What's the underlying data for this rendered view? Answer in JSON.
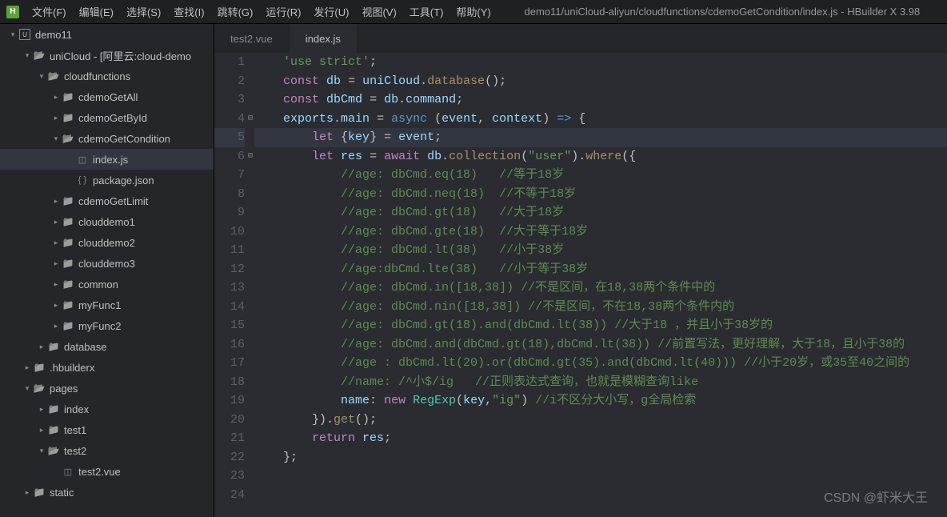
{
  "menubar": {
    "logo": "H",
    "items": [
      "文件(F)",
      "编辑(E)",
      "选择(S)",
      "查找(I)",
      "跳转(G)",
      "运行(R)",
      "发行(U)",
      "视图(V)",
      "工具(T)",
      "帮助(Y)"
    ],
    "title": "demo11/uniCloud-aliyun/cloudfunctions/cdemoGetCondition/index.js - HBuilder X 3.98"
  },
  "tree": [
    {
      "depth": 0,
      "chev": "▾",
      "icon": "proj",
      "label": "demo11"
    },
    {
      "depth": 1,
      "chev": "▾",
      "icon": "folder-open",
      "label": "uniCloud - [阿里云:cloud-demo"
    },
    {
      "depth": 2,
      "chev": "▾",
      "icon": "folder-open",
      "label": "cloudfunctions"
    },
    {
      "depth": 3,
      "chev": "▸",
      "icon": "folder",
      "label": "cdemoGetAll"
    },
    {
      "depth": 3,
      "chev": "▸",
      "icon": "folder",
      "label": "cdemoGetById"
    },
    {
      "depth": 3,
      "chev": "▾",
      "icon": "folder-open",
      "label": "cdemoGetCondition"
    },
    {
      "depth": 4,
      "chev": "",
      "icon": "file",
      "label": "index.js",
      "selected": true,
      "fileGlyph": "◫"
    },
    {
      "depth": 4,
      "chev": "",
      "icon": "file",
      "label": "package.json",
      "fileGlyph": "{ }"
    },
    {
      "depth": 3,
      "chev": "▸",
      "icon": "folder",
      "label": "cdemoGetLimit"
    },
    {
      "depth": 3,
      "chev": "▸",
      "icon": "folder",
      "label": "clouddemo1"
    },
    {
      "depth": 3,
      "chev": "▸",
      "icon": "folder",
      "label": "clouddemo2"
    },
    {
      "depth": 3,
      "chev": "▸",
      "icon": "folder",
      "label": "clouddemo3"
    },
    {
      "depth": 3,
      "chev": "▸",
      "icon": "folder",
      "label": "common"
    },
    {
      "depth": 3,
      "chev": "▸",
      "icon": "folder",
      "label": "myFunc1"
    },
    {
      "depth": 3,
      "chev": "▸",
      "icon": "folder",
      "label": "myFunc2"
    },
    {
      "depth": 2,
      "chev": "▸",
      "icon": "folder",
      "label": "database"
    },
    {
      "depth": 1,
      "chev": "▸",
      "icon": "folder",
      "label": ".hbuilderx"
    },
    {
      "depth": 1,
      "chev": "▾",
      "icon": "folder-open",
      "label": "pages"
    },
    {
      "depth": 2,
      "chev": "▸",
      "icon": "folder",
      "label": "index"
    },
    {
      "depth": 2,
      "chev": "▸",
      "icon": "folder",
      "label": "test1"
    },
    {
      "depth": 2,
      "chev": "▾",
      "icon": "folder-open",
      "label": "test2"
    },
    {
      "depth": 3,
      "chev": "",
      "icon": "file",
      "label": "test2.vue",
      "fileGlyph": "◫"
    },
    {
      "depth": 1,
      "chev": "▸",
      "icon": "folder",
      "label": "static"
    }
  ],
  "tabs": [
    {
      "label": "test2.vue",
      "active": false
    },
    {
      "label": "index.js",
      "active": true
    }
  ],
  "code": [
    {
      "n": 1,
      "tokens": [
        [
          "pun",
          "    "
        ],
        [
          "str",
          "'use strict'"
        ],
        [
          "pun",
          ";"
        ]
      ]
    },
    {
      "n": 2,
      "tokens": [
        [
          "pun",
          "    "
        ],
        [
          "kw",
          "const"
        ],
        [
          "pun",
          " "
        ],
        [
          "var",
          "db"
        ],
        [
          "pun",
          " "
        ],
        [
          "op",
          "="
        ],
        [
          "pun",
          " "
        ],
        [
          "var",
          "uniCloud"
        ],
        [
          "pun",
          "."
        ],
        [
          "fn",
          "database"
        ],
        [
          "pun",
          "();"
        ]
      ]
    },
    {
      "n": 3,
      "tokens": [
        [
          "pun",
          "    "
        ],
        [
          "kw",
          "const"
        ],
        [
          "pun",
          " "
        ],
        [
          "var",
          "dbCmd"
        ],
        [
          "pun",
          " "
        ],
        [
          "op",
          "="
        ],
        [
          "pun",
          " "
        ],
        [
          "var",
          "db"
        ],
        [
          "pun",
          "."
        ],
        [
          "var",
          "command"
        ],
        [
          "pun",
          ";"
        ]
      ]
    },
    {
      "n": 4,
      "fold": "⊟",
      "tokens": [
        [
          "pun",
          "    "
        ],
        [
          "var",
          "exports"
        ],
        [
          "pun",
          "."
        ],
        [
          "var",
          "main"
        ],
        [
          "pun",
          " "
        ],
        [
          "op",
          "="
        ],
        [
          "pun",
          " "
        ],
        [
          "kw2",
          "async"
        ],
        [
          "pun",
          " ("
        ],
        [
          "var",
          "event"
        ],
        [
          "pun",
          ", "
        ],
        [
          "var",
          "context"
        ],
        [
          "pun",
          ") "
        ],
        [
          "arrow",
          "=>"
        ],
        [
          "pun",
          " {"
        ]
      ]
    },
    {
      "n": 5,
      "hl": true,
      "tokens": [
        [
          "pun",
          "        "
        ],
        [
          "kw",
          "let"
        ],
        [
          "pun",
          " {"
        ],
        [
          "var",
          "key"
        ],
        [
          "pun",
          "} "
        ],
        [
          "op",
          "="
        ],
        [
          "pun",
          " "
        ],
        [
          "var",
          "event"
        ],
        [
          "pun",
          ";"
        ]
      ]
    },
    {
      "n": 6,
      "fold": "⊟",
      "tokens": [
        [
          "pun",
          "        "
        ],
        [
          "kw",
          "let"
        ],
        [
          "pun",
          " "
        ],
        [
          "var",
          "res"
        ],
        [
          "pun",
          " "
        ],
        [
          "op",
          "="
        ],
        [
          "pun",
          " "
        ],
        [
          "kw",
          "await"
        ],
        [
          "pun",
          " "
        ],
        [
          "var",
          "db"
        ],
        [
          "pun",
          "."
        ],
        [
          "fn",
          "collection"
        ],
        [
          "pun",
          "("
        ],
        [
          "str",
          "\"user\""
        ],
        [
          "pun",
          ")."
        ],
        [
          "fn",
          "where"
        ],
        [
          "pun",
          "({"
        ]
      ]
    },
    {
      "n": 7,
      "tokens": [
        [
          "pun",
          "            "
        ],
        [
          "cmt",
          "//age: dbCmd.eq(18)   //等于18岁"
        ]
      ]
    },
    {
      "n": 8,
      "tokens": [
        [
          "pun",
          "            "
        ],
        [
          "cmt",
          "//age: dbCmd.neq(18)  //不等于18岁"
        ]
      ]
    },
    {
      "n": 9,
      "tokens": [
        [
          "pun",
          "            "
        ],
        [
          "cmt",
          "//age: dbCmd.gt(18)   //大于18岁"
        ]
      ]
    },
    {
      "n": 10,
      "tokens": [
        [
          "pun",
          "            "
        ],
        [
          "cmt",
          "//age: dbCmd.gte(18)  //大于等于18岁"
        ]
      ]
    },
    {
      "n": 11,
      "tokens": [
        [
          "pun",
          "            "
        ],
        [
          "cmt",
          "//age: dbCmd.lt(38)   //小于38岁"
        ]
      ]
    },
    {
      "n": 12,
      "tokens": [
        [
          "pun",
          "            "
        ],
        [
          "cmt",
          "//age:dbCmd.lte(38)   //小于等于38岁"
        ]
      ]
    },
    {
      "n": 13,
      "tokens": [
        [
          "pun",
          "            "
        ],
        [
          "cmt",
          "//age: dbCmd.in([18,38]) //不是区间，在18,38两个条件中的"
        ]
      ]
    },
    {
      "n": 14,
      "tokens": [
        [
          "pun",
          "            "
        ],
        [
          "cmt",
          "//age: dbCmd.nin([18,38]) //不是区间，不在18,38两个条件内的"
        ]
      ]
    },
    {
      "n": 15,
      "tokens": [
        [
          "pun",
          "            "
        ],
        [
          "cmt",
          "//age: dbCmd.gt(18).and(dbCmd.lt(38)) //大于18 ，并且小于38岁的"
        ]
      ]
    },
    {
      "n": 16,
      "tokens": [
        [
          "pun",
          "            "
        ],
        [
          "cmt",
          "//age: dbCmd.and(dbCmd.gt(18),dbCmd.lt(38)) //前置写法，更好理解，大于18，且小于38的"
        ]
      ]
    },
    {
      "n": 17,
      "tokens": [
        [
          "pun",
          "            "
        ],
        [
          "cmt",
          "//age : dbCmd.lt(20).or(dbCmd.gt(35).and(dbCmd.lt(40))) //小于20岁，或35至40之间的"
        ]
      ]
    },
    {
      "n": 18,
      "tokens": [
        [
          "pun",
          "            "
        ],
        [
          "cmt",
          "//name: /^小$/ig   //正则表达式查询，也就是模糊查询like"
        ]
      ]
    },
    {
      "n": 19,
      "tokens": [
        [
          "pun",
          "            "
        ],
        [
          "var",
          "name"
        ],
        [
          "pun",
          ": "
        ],
        [
          "kw",
          "new"
        ],
        [
          "pun",
          " "
        ],
        [
          "cls",
          "RegExp"
        ],
        [
          "pun",
          "("
        ],
        [
          "var",
          "key"
        ],
        [
          "pun",
          ","
        ],
        [
          "str",
          "\"ig\""
        ],
        [
          "pun",
          ") "
        ],
        [
          "cmt",
          "//i不区分大小写，g全局检索"
        ]
      ]
    },
    {
      "n": 20,
      "tokens": [
        [
          "pun",
          "        })."
        ],
        [
          "fn",
          "get"
        ],
        [
          "pun",
          "();"
        ]
      ]
    },
    {
      "n": 21,
      "tokens": [
        [
          "pun",
          ""
        ]
      ]
    },
    {
      "n": 22,
      "tokens": [
        [
          "pun",
          "        "
        ],
        [
          "kw",
          "return"
        ],
        [
          "pun",
          " "
        ],
        [
          "var",
          "res"
        ],
        [
          "pun",
          ";"
        ]
      ]
    },
    {
      "n": 23,
      "tokens": [
        [
          "pun",
          "    };"
        ]
      ]
    },
    {
      "n": 24,
      "tokens": [
        [
          "pun",
          ""
        ]
      ]
    }
  ],
  "watermark": "CSDN @虾米大王"
}
